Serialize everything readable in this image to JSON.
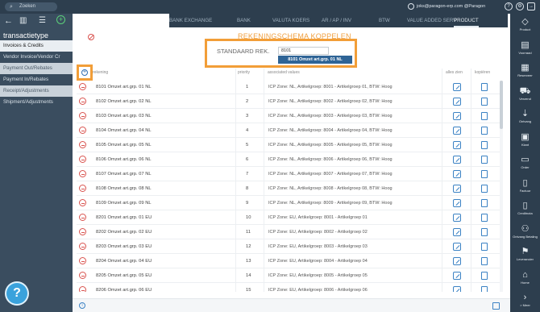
{
  "topbar": {
    "search_placeholder": "Zoeken",
    "user_email": "joks@paragon-erp.com @Paragon"
  },
  "left_sidebar": {
    "title": "transactietype",
    "items": [
      {
        "label": "Invoices & Credits",
        "state": "active"
      },
      {
        "label": "Vendor Invoice/Vendor Cr",
        "state": "normal"
      },
      {
        "label": "Payment Out/Rebates",
        "state": "alt"
      },
      {
        "label": "Payment In/Rebates",
        "state": "normal"
      },
      {
        "label": "Receipt/Adjustments",
        "state": "alt"
      },
      {
        "label": "Shipment/Adjustments",
        "state": "normal"
      }
    ],
    "help_label": "?"
  },
  "tabs": [
    "BANK EXCHANGE",
    "BANK",
    "VALUTA KOERS",
    "AR / AP / INV",
    "BTW",
    "VALUE ADDED SERV",
    "PRODUCT"
  ],
  "active_tab": "PRODUCT",
  "right_sidebar": [
    {
      "label": "Product",
      "icon": "tag-icon"
    },
    {
      "label": "Voorraad",
      "icon": "box-icon"
    },
    {
      "label": "Reserveer",
      "icon": "clipboard-icon"
    },
    {
      "label": "Verzend",
      "icon": "truck-icon"
    },
    {
      "label": "Ontvang",
      "icon": "inbox-icon"
    },
    {
      "label": "Klant",
      "icon": "cart-icon"
    },
    {
      "label": "Order",
      "icon": "order-icon"
    },
    {
      "label": "Factuur",
      "icon": "invoice-icon"
    },
    {
      "label": "Creditnota",
      "icon": "creditnote-icon"
    },
    {
      "label": "Ontvang Betaling",
      "icon": "payment-icon"
    },
    {
      "label": "Leverancier",
      "icon": "supplier-icon"
    },
    {
      "label": "Home",
      "icon": "home-icon"
    },
    {
      "label": "> Meer",
      "icon": "more-icon"
    }
  ],
  "main": {
    "title": "REKENINGSCHEMA KOPPELEN",
    "standaard_label": "STANDAARD REK.",
    "standaard_value": "8101",
    "suggestion": "8101 Omzet art.grp. 01 NL"
  },
  "table": {
    "headers": [
      "rekening",
      "priority",
      "associated values",
      "alles zien",
      "kopiëren"
    ],
    "rows": [
      {
        "account": "8101 Omzet art.grp. 01  NL",
        "priority": "1",
        "assoc": "ICP Zone: NL, Artikelgroep: 8001 - Artikelgroep 01, BTW: Hoog"
      },
      {
        "account": "8102 Omzet art.grp. 02  NL",
        "priority": "2",
        "assoc": "ICP Zone: NL, Artikelgroep: 8002 - Artikelgroep 02, BTW: Hoog"
      },
      {
        "account": "8103 Omzet art.grp. 03  NL",
        "priority": "3",
        "assoc": "ICP Zone: NL, Artikelgroep: 8003 - Artikelgroep 03, BTW: Hoog"
      },
      {
        "account": "8104 Omzet art.grp. 04  NL",
        "priority": "4",
        "assoc": "ICP Zone: NL, Artikelgroep: 8004 - Artikelgroep 04, BTW: Hoog"
      },
      {
        "account": "8105 Omzet art.grp. 05  NL",
        "priority": "5",
        "assoc": "ICP Zone: NL, Artikelgroep: 8005 - Artikelgroep 05, BTW: Hoog"
      },
      {
        "account": "8106 Omzet art.grp. 06  NL",
        "priority": "6",
        "assoc": "ICP Zone: NL, Artikelgroep: 8006 - Artikelgroep 06, BTW: Hoog"
      },
      {
        "account": "8107 Omzet art.grp. 07  NL",
        "priority": "7",
        "assoc": "ICP Zone: NL, Artikelgroep: 8007 - Artikelgroep 07, BTW: Hoog"
      },
      {
        "account": "8108 Omzet art.grp. 08  NL",
        "priority": "8",
        "assoc": "ICP Zone: NL, Artikelgroep: 8008 - Artikelgroep 08, BTW: Hoog"
      },
      {
        "account": "8109 Omzet art.grp. 09  NL",
        "priority": "9",
        "assoc": "ICP Zone: NL, Artikelgroep: 8009 - Artikelgroep 09, BTW: Hoog"
      },
      {
        "account": "8201 Omzet art.grp. 01  EU",
        "priority": "10",
        "assoc": "ICP Zone: EU, Artikelgroep: 8001 - Artikelgroep 01"
      },
      {
        "account": "8202 Omzet art.grp. 02  EU",
        "priority": "11",
        "assoc": "ICP Zone: EU, Artikelgroep: 8002 - Artikelgroep 02"
      },
      {
        "account": "8203 Omzet art.grp. 03  EU",
        "priority": "12",
        "assoc": "ICP Zone: EU, Artikelgroep: 8003 - Artikelgroep 03"
      },
      {
        "account": "8204 Omzet art.grp. 04  EU",
        "priority": "13",
        "assoc": "ICP Zone: EU, Artikelgroep: 8004 - Artikelgroep 04"
      },
      {
        "account": "8205 Omzet art.grp. 05  EU",
        "priority": "14",
        "assoc": "ICP Zone: EU, Artikelgroep: 8005 - Artikelgroep 05"
      },
      {
        "account": "8206 Omzet art.grp. 06  EU",
        "priority": "15",
        "assoc": "ICP Zone: EU, Artikelgroep: 8006 - Artikelgroep 06"
      }
    ]
  },
  "colors": {
    "dark_bar": "#2d3e4e",
    "highlight_orange": "#f29e38",
    "title_orange": "#f0a040",
    "link_blue": "#3b82c4",
    "delete_red": "#d9534f"
  }
}
